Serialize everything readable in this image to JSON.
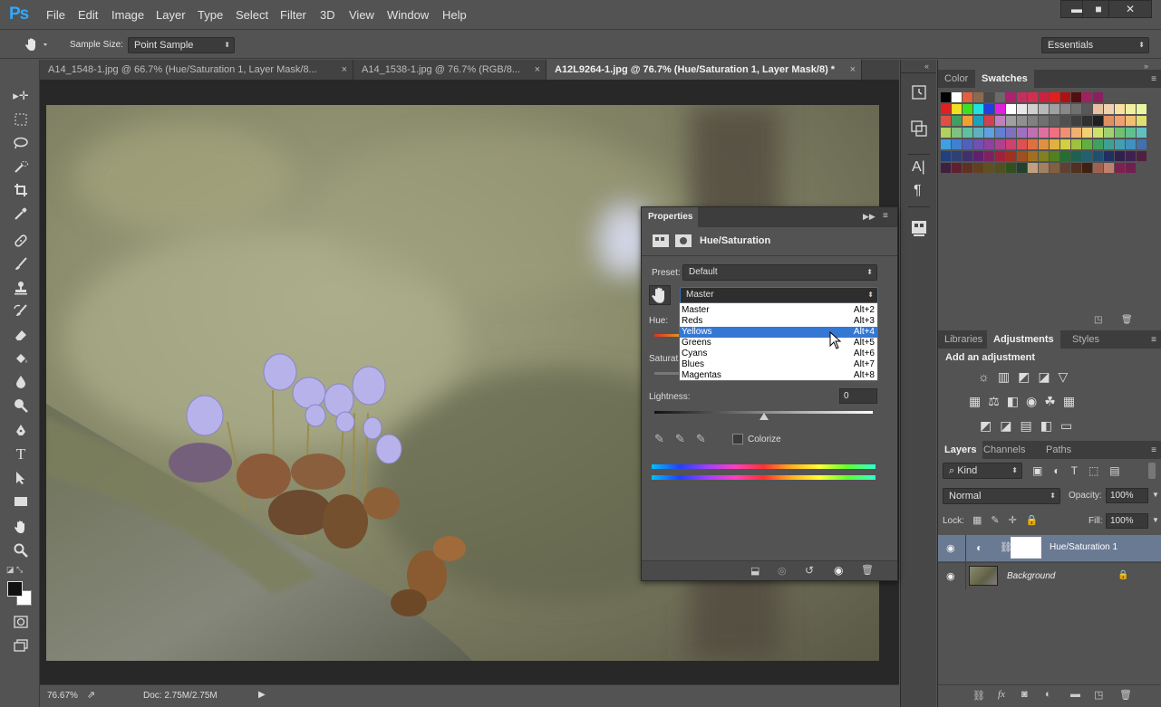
{
  "app": {
    "logo": "Ps"
  },
  "menu": [
    "File",
    "Edit",
    "Image",
    "Layer",
    "Type",
    "Select",
    "Filter",
    "3D",
    "View",
    "Window",
    "Help"
  ],
  "window_controls": {
    "minimize": "▬",
    "maximize": "■",
    "close": "✕"
  },
  "options": {
    "sample_size_label": "Sample Size:",
    "sample_size_value": "Point Sample",
    "workspace": "Essentials"
  },
  "tabs": [
    {
      "title": "A14_1548-1.jpg @ 66.7% (Hue/Saturation 1, Layer Mask/8...",
      "close": "×"
    },
    {
      "title": "A14_1538-1.jpg @ 76.7% (RGB/8...",
      "close": "×"
    },
    {
      "title": "A12L9264-1.jpg @ 76.7% (Hue/Saturation 1, Layer Mask/8) *",
      "close": "×"
    }
  ],
  "status": {
    "zoom": "76.67%",
    "doc": "Doc: 2.75M/2.75M"
  },
  "properties": {
    "tab": "Properties",
    "title": "Hue/Saturation",
    "preset_label": "Preset:",
    "preset_value": "Default",
    "channel_value": "Master",
    "hue_label": "Hue:",
    "saturation_label": "Saturat",
    "lightness_label": "Lightness:",
    "lightness_value": "0",
    "colorize_label": "Colorize",
    "channel_options": [
      {
        "name": "Master",
        "shortcut": "Alt+2"
      },
      {
        "name": "Reds",
        "shortcut": "Alt+3"
      },
      {
        "name": "Yellows",
        "shortcut": "Alt+4"
      },
      {
        "name": "Greens",
        "shortcut": "Alt+5"
      },
      {
        "name": "Cyans",
        "shortcut": "Alt+6"
      },
      {
        "name": "Blues",
        "shortcut": "Alt+7"
      },
      {
        "name": "Magentas",
        "shortcut": "Alt+8"
      }
    ],
    "highlighted_option": "Yellows"
  },
  "color_panel": {
    "tabs": [
      "Color",
      "Swatches"
    ]
  },
  "adjustments_panel": {
    "tabs": [
      "Libraries",
      "Adjustments",
      "Styles"
    ],
    "heading": "Add an adjustment"
  },
  "layers_panel": {
    "tabs": [
      "Layers",
      "Channels",
      "Paths"
    ],
    "filter_kind": "Kind",
    "blend_mode": "Normal",
    "opacity_label": "Opacity:",
    "opacity_value": "100%",
    "lock_label": "Lock:",
    "fill_label": "Fill:",
    "fill_value": "100%",
    "layers": [
      {
        "name": "Hue/Saturation 1",
        "selected": true
      },
      {
        "name": "Background",
        "selected": false
      }
    ]
  },
  "colors": {
    "accent": "#31a8ff",
    "ui_bg": "#535353",
    "selection": "#3478d4"
  }
}
